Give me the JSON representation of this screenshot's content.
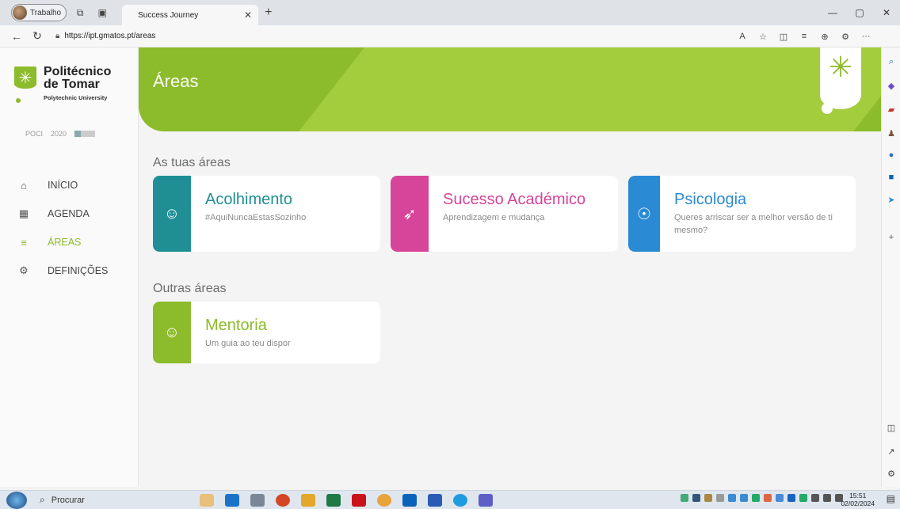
{
  "browser": {
    "profile_label": "Trabalho",
    "tab_title": "Success Journey",
    "url": "https://ipt.gmatos.pt/areas",
    "window_controls": [
      "—",
      "▢",
      "✕"
    ]
  },
  "sidebar": {
    "logo": {
      "line1": "Politécnico",
      "line2": "de Tomar",
      "line3": "Polytechnic University"
    },
    "partners": [
      "POCI",
      "2020"
    ],
    "items": [
      {
        "label": "INÍCIO",
        "icon": "home-icon",
        "active": false
      },
      {
        "label": "AGENDA",
        "icon": "calendar-icon",
        "active": false
      },
      {
        "label": "ÁREAS",
        "icon": "menu-icon",
        "active": true
      },
      {
        "label": "DEFINIÇÕES",
        "icon": "gear-icon",
        "active": false
      }
    ]
  },
  "header": {
    "title": "Áreas"
  },
  "sections": {
    "tuas": "As tuas áreas",
    "outras": "Outras áreas"
  },
  "cards": [
    {
      "title": "Acolhimento",
      "subtitle": "#AquiNuncaEstasSozinho",
      "color": "#1f8f95",
      "icon": "hands-heart-icon"
    },
    {
      "title": "Sucesso Académico",
      "subtitle": "Aprendizagem e mudança",
      "color": "#d6459a",
      "icon": "rocket-icon"
    },
    {
      "title": "Psicologia",
      "subtitle": "Queres arriscar ser a melhor versão de ti mesmo?",
      "color": "#2a8ad4",
      "icon": "head-icon"
    },
    {
      "title": "Mentoria",
      "subtitle": "Um guia ao teu dispor",
      "color": "#8cbb2b",
      "icon": "hands-heart-icon"
    }
  ],
  "taskbar": {
    "search_label": "Procurar",
    "time": "15:51",
    "date": "02/02/2024"
  },
  "colors": {
    "brand_green": "#8cbb2b",
    "banner_light": "#a3cd3d"
  }
}
